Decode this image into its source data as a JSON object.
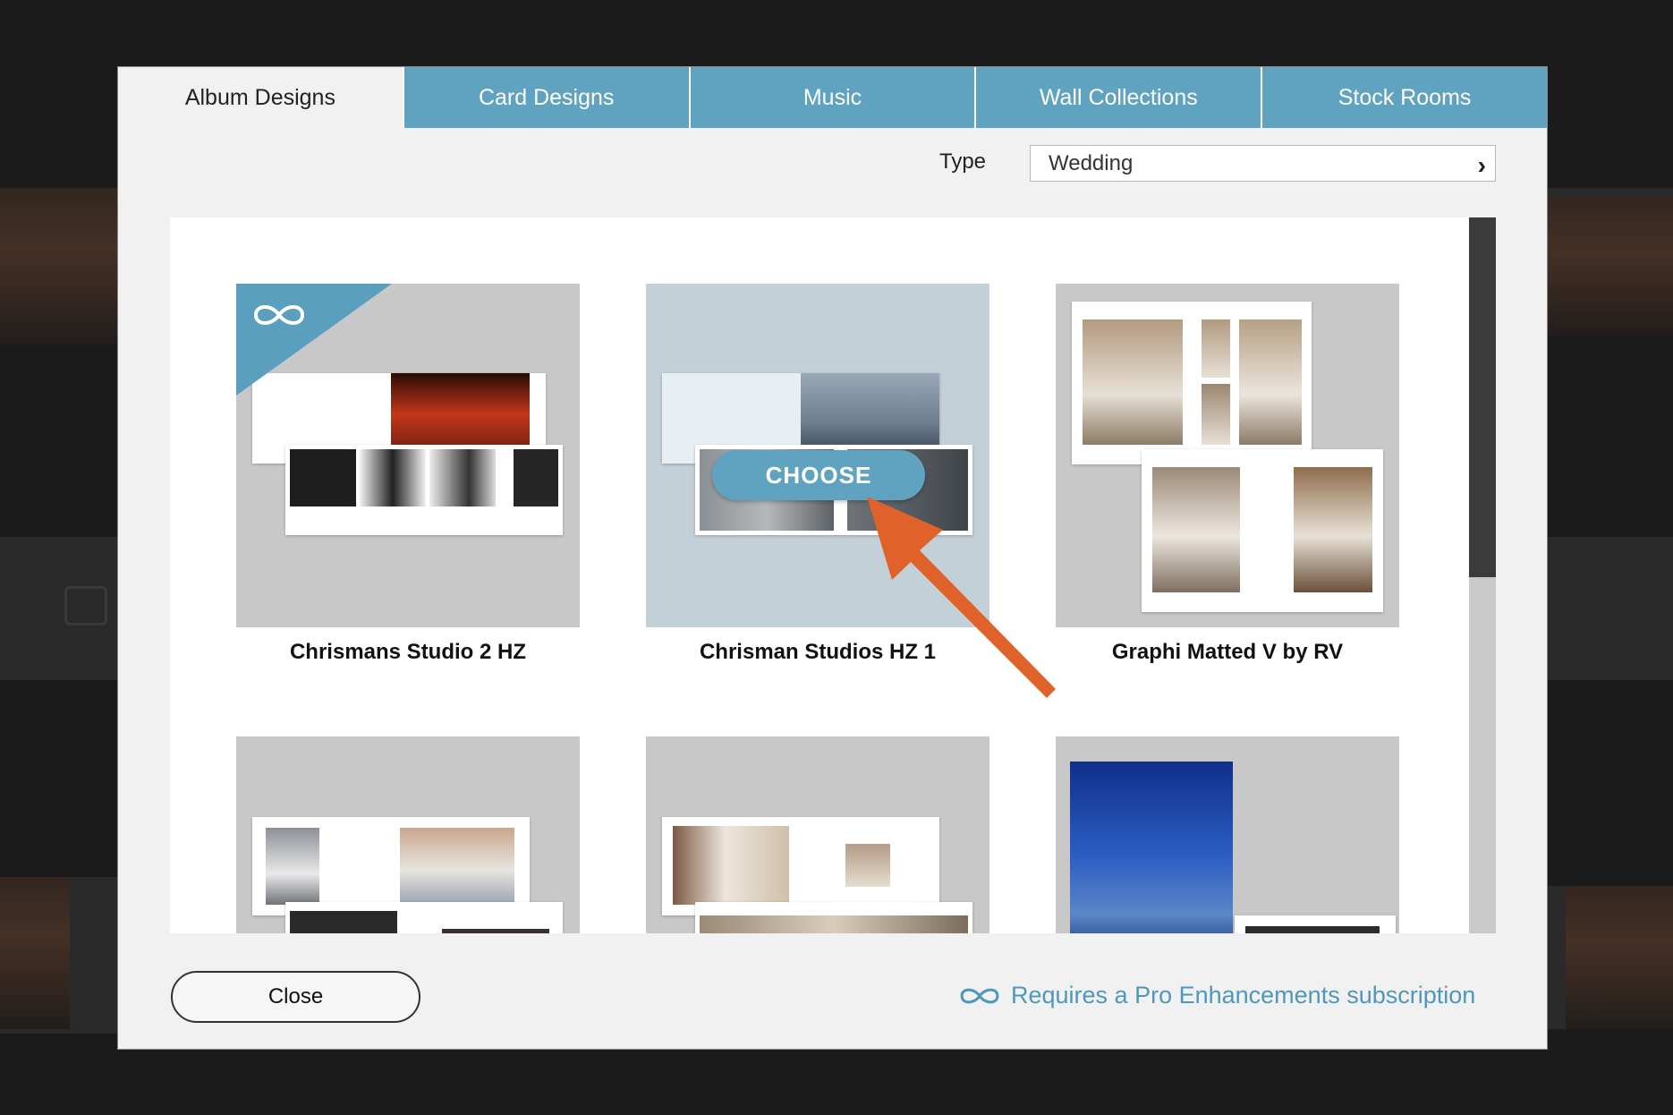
{
  "tabs": [
    {
      "label": "Album Designs",
      "active": true
    },
    {
      "label": "Card Designs",
      "active": false
    },
    {
      "label": "Music",
      "active": false
    },
    {
      "label": "Wall Collections",
      "active": false
    },
    {
      "label": "Stock Rooms",
      "active": false
    }
  ],
  "type_filter": {
    "label": "Type",
    "value": "Wedding"
  },
  "designs": [
    {
      "title": "Chrismans Studio 2 HZ",
      "pro": true
    },
    {
      "title": "Chrisman Studios HZ 1",
      "pro": false,
      "hover_action": "CHOOSE"
    },
    {
      "title": "Graphi Matted V by RV",
      "pro": false
    },
    {
      "title": "",
      "pro": false
    },
    {
      "title": "",
      "pro": false
    },
    {
      "title": "",
      "pro": false
    }
  ],
  "footer": {
    "close_label": "Close",
    "pro_note": "Requires a Pro Enhancements subscription"
  },
  "colors": {
    "accent": "#5fa3c1",
    "annotation_arrow": "#e0622b"
  }
}
